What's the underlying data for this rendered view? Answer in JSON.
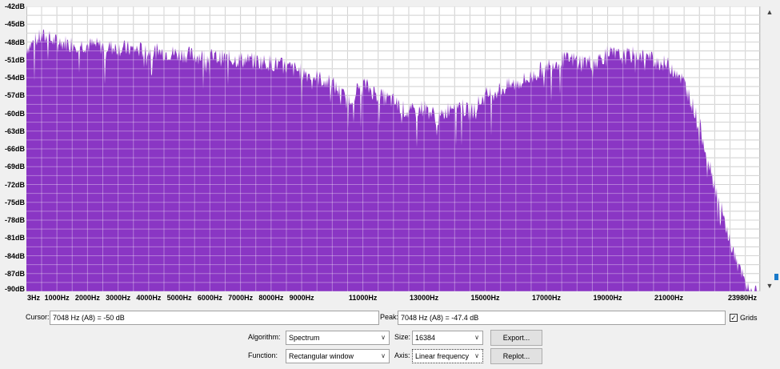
{
  "plot": {
    "y_labels": [
      "-42dB",
      "-45dB",
      "-48dB",
      "-51dB",
      "-54dB",
      "-57dB",
      "-60dB",
      "-63dB",
      "-66dB",
      "-69dB",
      "-72dB",
      "-75dB",
      "-78dB",
      "-81dB",
      "-84dB",
      "-87dB",
      "-90dB"
    ],
    "x_labels": [
      "3Hz",
      "1000Hz",
      "2000Hz",
      "3000Hz",
      "4000Hz",
      "5000Hz",
      "6000Hz",
      "7000Hz",
      "8000Hz",
      "9000Hz",
      "11000Hz",
      "13000Hz",
      "15000Hz",
      "17000Hz",
      "19000Hz",
      "21000Hz",
      "23980Hz"
    ],
    "fill_color": "#8a36c4",
    "grid_color": "#bdbdbd",
    "background": "#ffffff"
  },
  "chart_data": {
    "type": "area",
    "xlabel": "",
    "ylabel": "",
    "xlim": [
      3,
      23980
    ],
    "ylim": [
      -90,
      -42
    ],
    "grid": true,
    "x": [
      3,
      500,
      1000,
      2000,
      3000,
      4000,
      5000,
      6000,
      7000,
      8000,
      9000,
      10000,
      10500,
      11000,
      11500,
      12000,
      12500,
      13000,
      13500,
      14000,
      14500,
      15000,
      15500,
      16000,
      16500,
      17000,
      17500,
      18000,
      18500,
      19000,
      19500,
      20000,
      20500,
      21000,
      21300,
      21600,
      22000,
      22400,
      22800,
      23200,
      23600,
      23980
    ],
    "values": [
      -49,
      -47,
      -48,
      -48.5,
      -49,
      -49.5,
      -50,
      -50.5,
      -51,
      -51.5,
      -53,
      -55,
      -58,
      -55,
      -57,
      -58,
      -60,
      -59,
      -61,
      -58,
      -60,
      -57,
      -56,
      -55,
      -54,
      -52,
      -51,
      -51,
      -51.5,
      -50,
      -50.5,
      -50,
      -51,
      -52,
      -53,
      -56,
      -62,
      -70,
      -78,
      -85,
      -90,
      -90
    ]
  },
  "controls": {
    "cursor_label": "Cursor:",
    "cursor_value": "7048 Hz (A8) = -50 dB",
    "peak_label": "Peak:",
    "peak_value": "7048 Hz (A8) = -47.4 dB",
    "grids_label": "Grids",
    "grids_checked": "✓",
    "algorithm_label": "Algorithm:",
    "algorithm_value": "Spectrum",
    "size_label": "Size:",
    "size_value": "16384",
    "function_label": "Function:",
    "function_value": "Rectangular window",
    "axis_label": "Axis:",
    "axis_value": "Linear frequency",
    "export_label": "Export...",
    "replot_label": "Replot..."
  }
}
